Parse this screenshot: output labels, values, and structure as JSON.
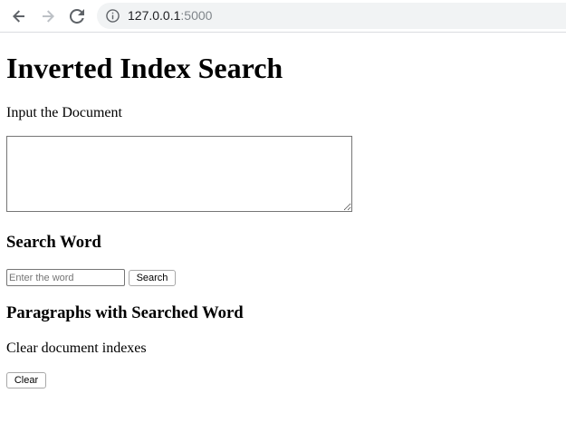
{
  "browser": {
    "url_host": "127.0.0.1",
    "url_port": ":5000",
    "icons": {
      "back": "arrow-left-icon",
      "forward": "arrow-right-icon",
      "reload": "reload-icon",
      "info": "info-icon"
    }
  },
  "page": {
    "title": "Inverted Index Search",
    "document_label": "Input the Document",
    "document_value": "",
    "search_heading": "Search Word",
    "search_placeholder": "Enter the word",
    "search_value": "",
    "search_button_label": "Search",
    "results_heading": "Paragraphs with Searched Word",
    "clear_label": "Clear document indexes",
    "clear_button_label": "Clear"
  },
  "colors": {
    "omnibox_bg": "#f1f3f4",
    "text": "#000000",
    "muted": "#80868b"
  }
}
